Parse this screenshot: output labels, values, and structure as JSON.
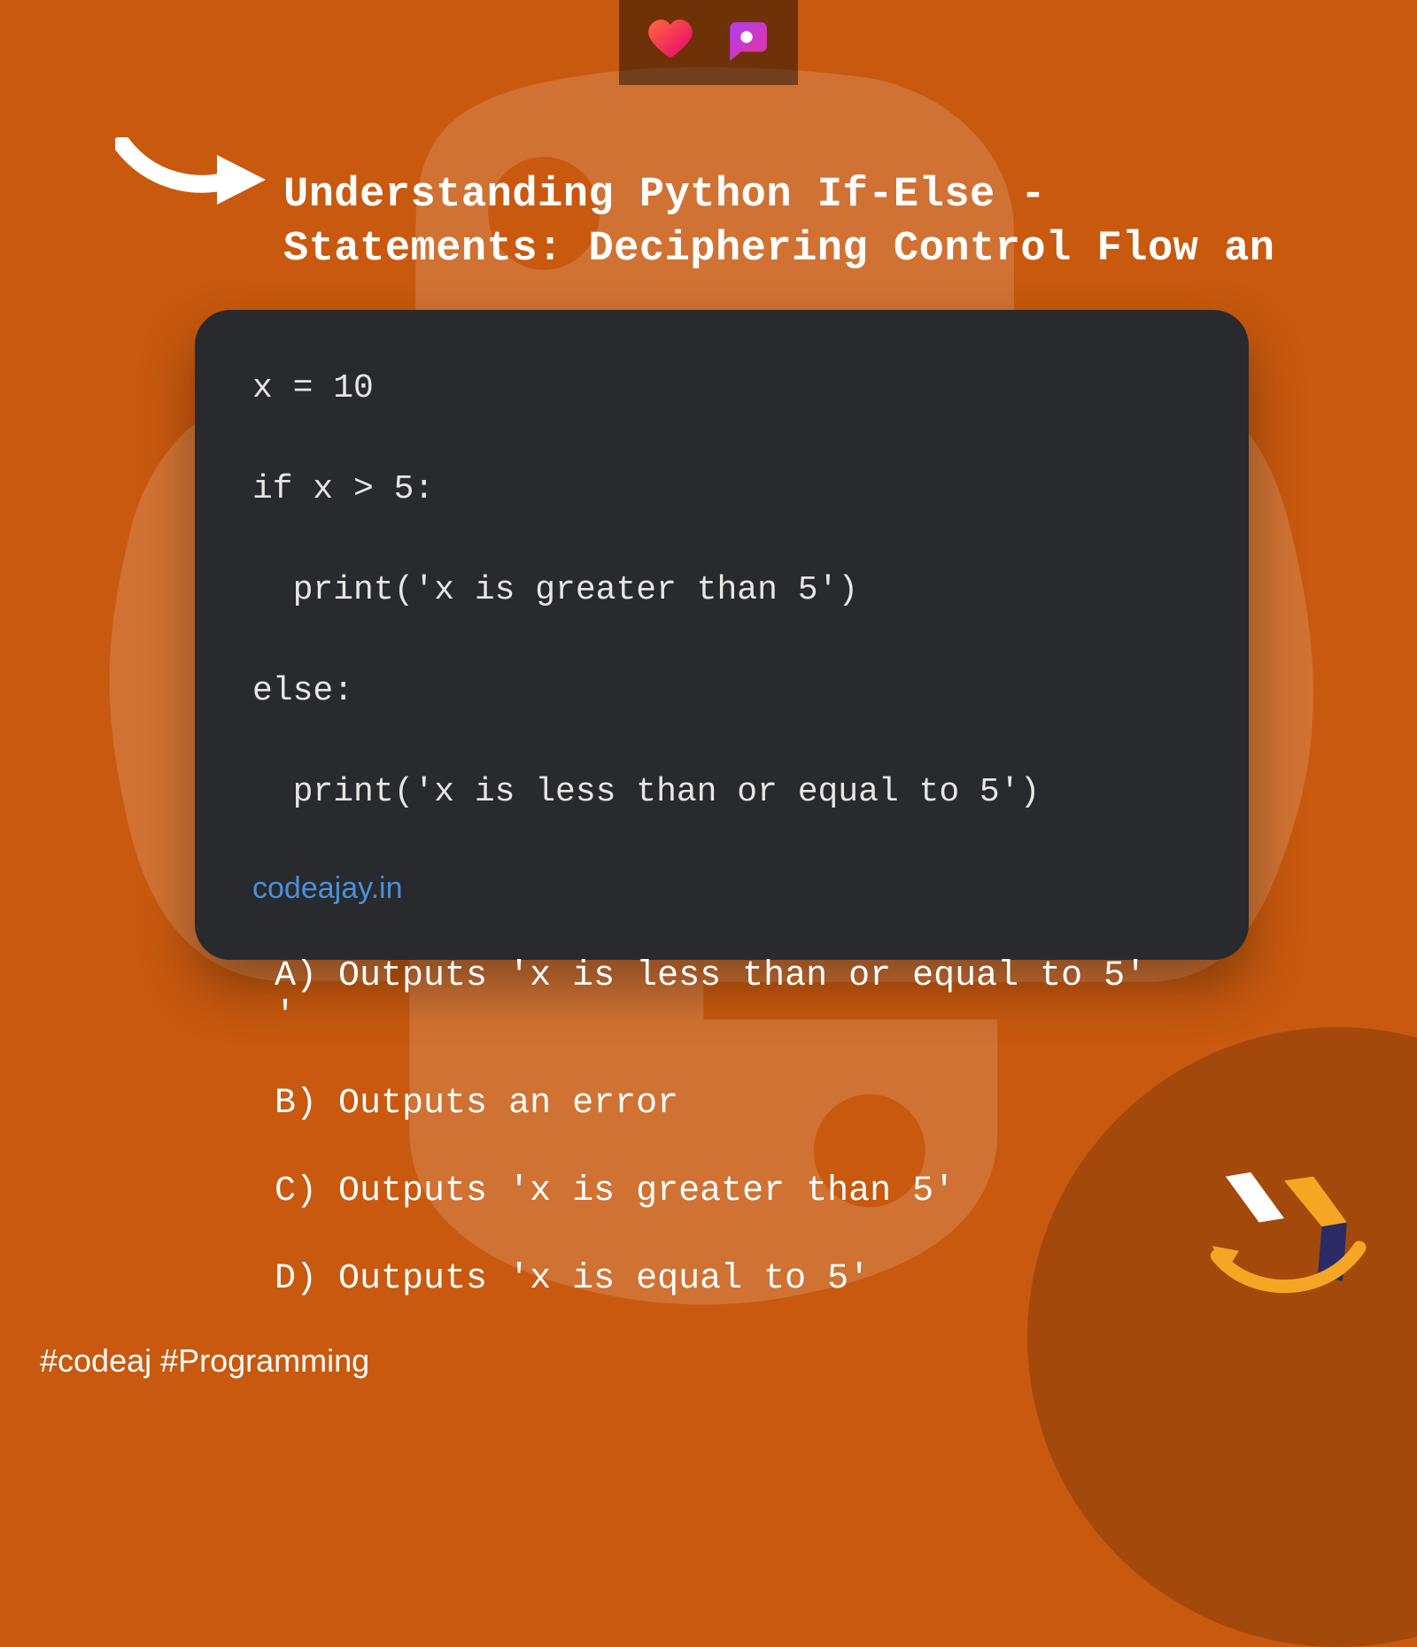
{
  "title_line1": "Understanding Python If-Else -",
  "title_line2": "Statements: Deciphering Control Flow an",
  "reactions": {
    "heart": "heart-icon",
    "chat": "chat-icon"
  },
  "code": {
    "lines": [
      "x = 10",
      "if x > 5:",
      "  print('x is greater than 5')",
      "else:",
      "  print('x is less than or equal to 5')"
    ],
    "source_link": "codeajay.in"
  },
  "options": [
    {
      "letter": "A",
      "text": "Outputs 'x is less than or equal to 5'"
    },
    {
      "letter": "B",
      "text": "Outputs an error"
    },
    {
      "letter": "C",
      "text": "Outputs 'x is greater than 5'"
    },
    {
      "letter": "D",
      "text": "Outputs 'x is equal to 5'"
    }
  ],
  "option_a_trailer": "'",
  "hashtags": "#codeaj #Programming",
  "colors": {
    "bg": "#c8590f",
    "code_bg": "#282a2e",
    "link": "#4a90d9"
  }
}
